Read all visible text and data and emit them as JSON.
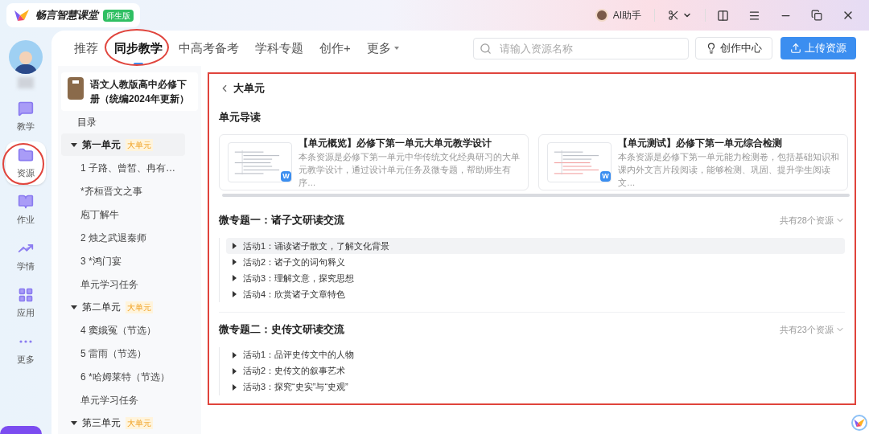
{
  "app": {
    "name": "畅言智慧课堂",
    "edition": "师生版"
  },
  "titlebar": {
    "assistant": "AI助手"
  },
  "nav": [
    {
      "label": "教学",
      "selected": false
    },
    {
      "label": "资源",
      "selected": true
    },
    {
      "label": "作业",
      "selected": false
    },
    {
      "label": "学情",
      "selected": false
    },
    {
      "label": "应用",
      "selected": false
    },
    {
      "label": "更多",
      "selected": false
    }
  ],
  "tabs": [
    {
      "label": "推荐",
      "kind": "plain",
      "selected": false
    },
    {
      "label": "同步教学",
      "kind": "plain",
      "selected": true
    },
    {
      "label": "中高考备考",
      "kind": "plain",
      "selected": false
    },
    {
      "label": "学科专题",
      "kind": "plain",
      "selected": false
    },
    {
      "label": "创作+",
      "kind": "plain",
      "selected": false
    },
    {
      "label": "更多",
      "kind": "menu",
      "selected": false
    }
  ],
  "search": {
    "placeholder": "请输入资源名称"
  },
  "buttons": [
    {
      "label": "创作中心",
      "kind": "secondary"
    },
    {
      "label": "上传资源",
      "kind": "primary"
    }
  ],
  "book": {
    "title": "语文人教版高中必修下册（统编2024年更新）"
  },
  "tree": {
    "toc": "目录",
    "units": [
      {
        "label": "第一单元",
        "tag": "大单元",
        "expanded": true,
        "selected": true,
        "children": [
          {
            "label": "1 子路、曾皙、冉有…",
            "selected": false
          },
          {
            "label": "*齐桓晋文之事",
            "selected": false
          },
          {
            "label": "庖丁解牛",
            "selected": false
          },
          {
            "label": "2 烛之武退秦师",
            "selected": false
          },
          {
            "label": "3 *鸿门宴",
            "selected": false
          },
          {
            "label": "单元学习任务",
            "selected": false
          }
        ]
      },
      {
        "label": "第二单元",
        "tag": "大单元",
        "expanded": true,
        "selected": false,
        "children": [
          {
            "label": "4 窦娥冤（节选）",
            "selected": false
          },
          {
            "label": "5 雷雨（节选）",
            "selected": false
          },
          {
            "label": "6 *哈姆莱特（节选）",
            "selected": false
          },
          {
            "label": "单元学习任务",
            "selected": false
          }
        ]
      },
      {
        "label": "第三单元",
        "tag": "大单元",
        "expanded": true,
        "selected": false
      }
    ]
  },
  "content": {
    "title": "大单元",
    "guide_heading": "单元导读",
    "cards": [
      {
        "title": "【单元概览】必修下第一单元大单元教学设计",
        "description": "本条资源是必修下第一单元中华传统文化经典研习的大单元教学设计，通过设计单元任务及微专题，帮助师生有序…",
        "file_badge": "W"
      },
      {
        "title": "【单元测试】必修下第一单元综合检测",
        "description": "本条资源是必修下第一单元能力检测卷，包括基础知识和课内外文言片段阅读，能够检测、巩固、提升学生阅读文…",
        "file_badge": "W"
      }
    ],
    "topics": [
      {
        "title": "微专题一：诸子文研读交流",
        "count": "共有28个资源",
        "activities": [
          {
            "label": "活动1：诵读诸子散文，了解文化背景",
            "expanded": false,
            "selected": true
          },
          {
            "label": "活动2：诸子文的词句释义",
            "expanded": false,
            "selected": false
          },
          {
            "label": "活动3：理解文意，探究思想",
            "expanded": false,
            "selected": false
          },
          {
            "label": "活动4：欣赏诸子文章特色",
            "expanded": false,
            "selected": false
          }
        ]
      },
      {
        "title": "微专题二：史传文研读交流",
        "count": "共有23个资源",
        "activities": [
          {
            "label": "活动1：品评史传文中的人物",
            "expanded": false,
            "selected": false
          },
          {
            "label": "活动2：史传文的叙事艺术",
            "expanded": false,
            "selected": false
          },
          {
            "label": "活动3：探究“史实”与“史观”",
            "expanded": false,
            "selected": false
          }
        ]
      }
    ]
  }
}
